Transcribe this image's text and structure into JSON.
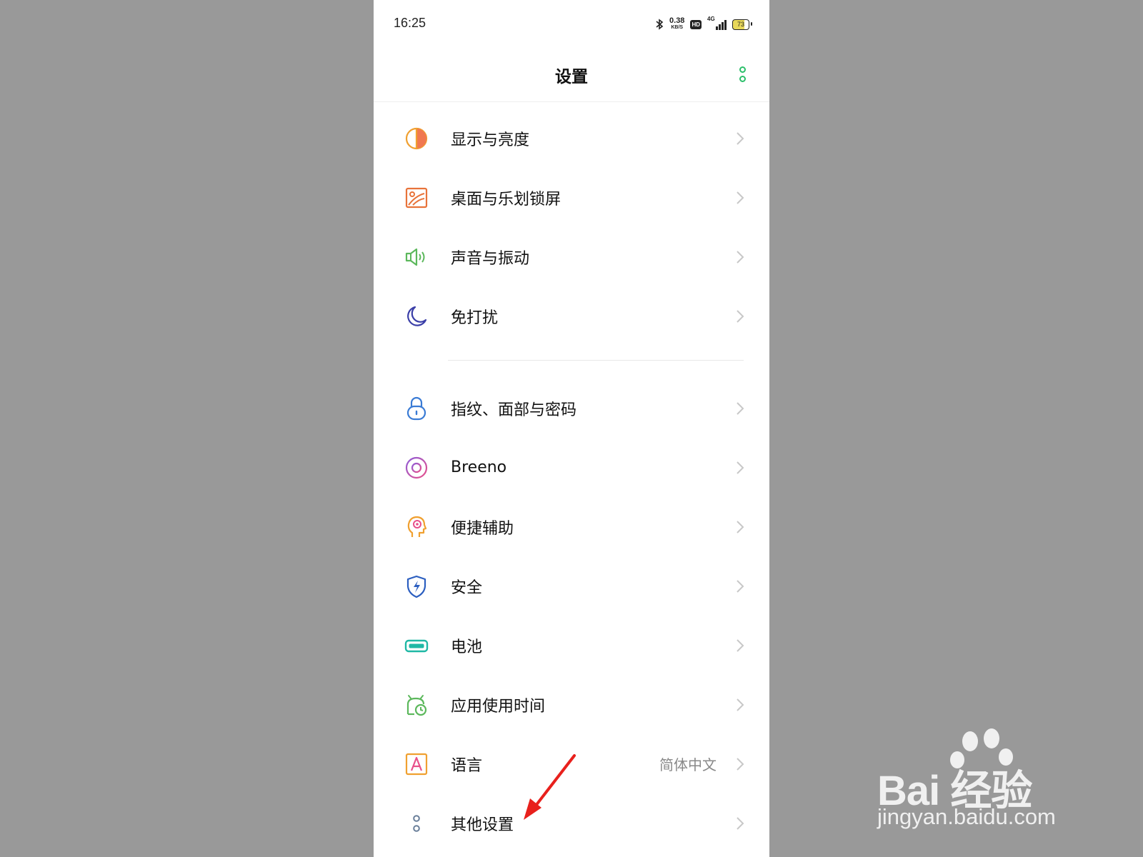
{
  "status_bar": {
    "time": "16:25",
    "net_speed_value": "0.38",
    "net_speed_unit": "KB/S",
    "hd_label": "HD",
    "network_label": "4G",
    "battery": "73",
    "icons": [
      "bluetooth-icon",
      "hd-icon",
      "signal-icon",
      "battery-icon"
    ]
  },
  "header": {
    "title": "设置",
    "more_icon": "more-vertical-icon"
  },
  "settings": {
    "group1": [
      {
        "label": "显示与亮度",
        "icon": "display-brightness-icon",
        "color": "#f0a030"
      },
      {
        "label": "桌面与乐划锁屏",
        "icon": "wallpaper-icon",
        "color": "#e8733a"
      },
      {
        "label": "声音与振动",
        "icon": "speaker-icon",
        "color": "#5cb85c"
      },
      {
        "label": "免打扰",
        "icon": "moon-icon",
        "color": "#3b3fa8"
      }
    ],
    "group2": [
      {
        "label": "指纹、面部与密码",
        "icon": "lock-icon",
        "color": "#3a7bd5"
      },
      {
        "label": "Breeno",
        "icon": "breeno-icon",
        "color": "#c84fb0"
      },
      {
        "label": "便捷辅助",
        "icon": "assist-head-icon",
        "color": "#f0a030"
      },
      {
        "label": "安全",
        "icon": "shield-icon",
        "color": "#2c5fc0"
      },
      {
        "label": "电池",
        "icon": "battery-setting-icon",
        "color": "#1fb8a5"
      },
      {
        "label": "应用使用时间",
        "icon": "app-time-icon",
        "color": "#5cb85c"
      },
      {
        "label": "语言",
        "value": "简体中文",
        "icon": "language-icon",
        "color": "#f0a030"
      },
      {
        "label": "其他设置",
        "icon": "other-settings-icon",
        "color": "#6a7f9a"
      }
    ]
  },
  "watermark": {
    "brand": "Bai 经验",
    "url": "jingyan.baidu.com"
  },
  "annotation": {
    "arrow_color": "#e8201c"
  }
}
